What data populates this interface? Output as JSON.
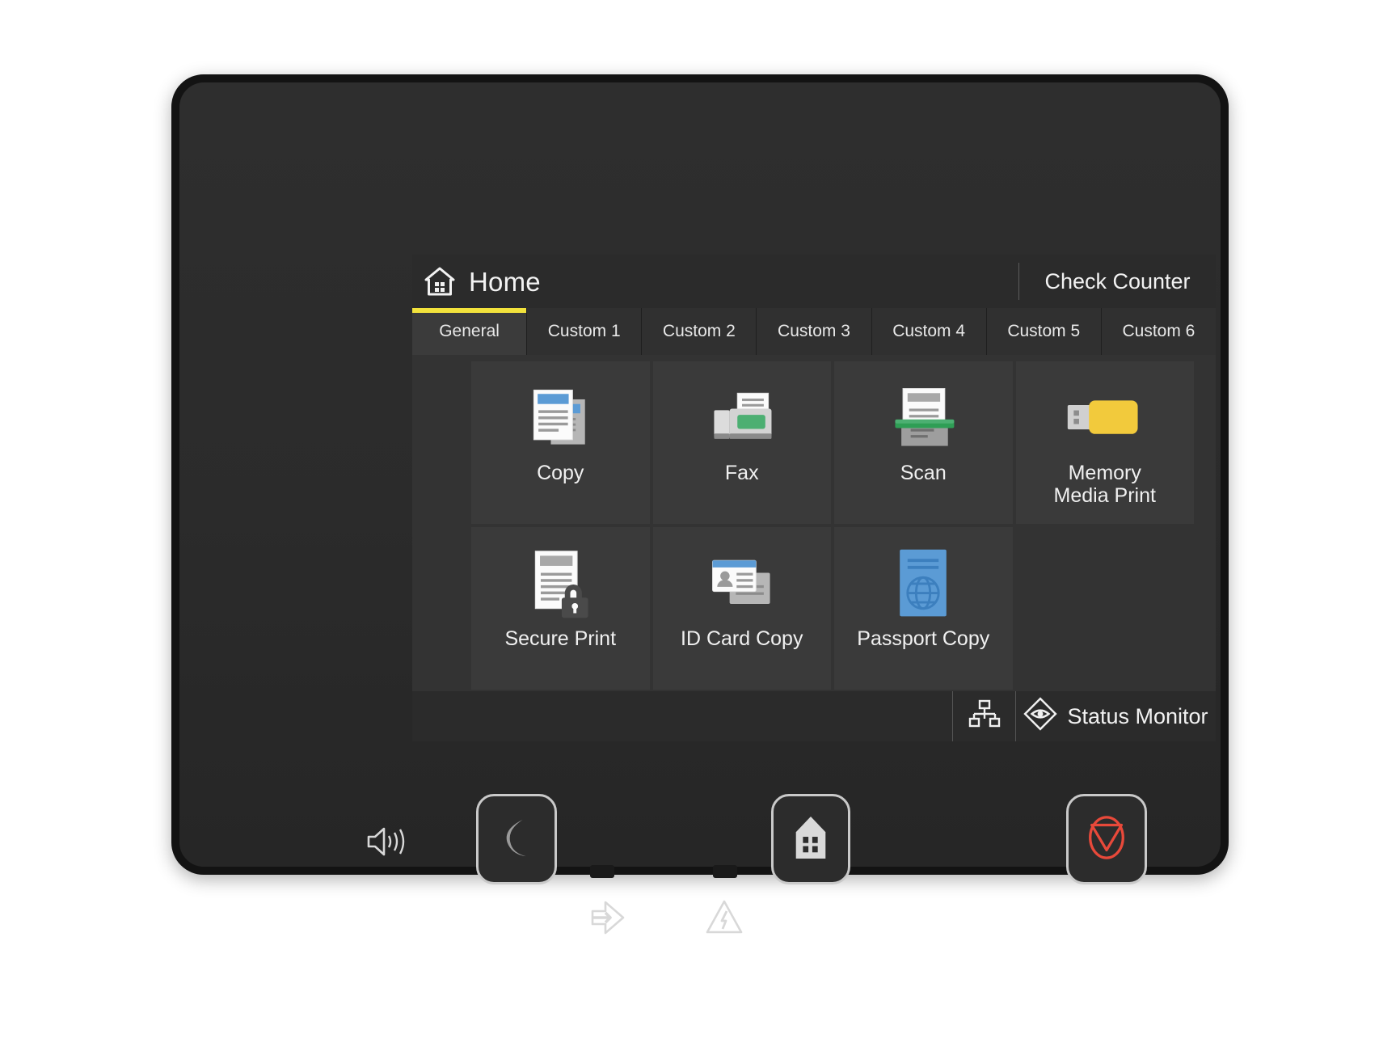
{
  "device": {
    "name": "multifunction-printer-control-panel"
  },
  "screen": {
    "header": {
      "home_icon": "home-icon",
      "title": "Home",
      "check_counter_label": "Check Counter"
    },
    "tabs": [
      {
        "label": "General",
        "active": true
      },
      {
        "label": "Custom 1",
        "active": false
      },
      {
        "label": "Custom 2",
        "active": false
      },
      {
        "label": "Custom 3",
        "active": false
      },
      {
        "label": "Custom 4",
        "active": false
      },
      {
        "label": "Custom 5",
        "active": false
      },
      {
        "label": "Custom 6",
        "active": false
      }
    ],
    "apps": [
      {
        "label": "Copy",
        "icon": "copy-document-icon"
      },
      {
        "label": "Fax",
        "icon": "fax-machine-icon"
      },
      {
        "label": "Scan",
        "icon": "scanner-icon"
      },
      {
        "label": "Memory\nMedia Print",
        "icon": "usb-flash-drive-icon"
      },
      {
        "label": "Secure Print",
        "icon": "document-lock-icon"
      },
      {
        "label": "ID Card Copy",
        "icon": "id-card-icon"
      },
      {
        "label": "Passport Copy",
        "icon": "passport-globe-icon"
      }
    ],
    "status_bar": {
      "network_icon": "network-lan-icon",
      "monitor_icon": "eye-diamond-icon",
      "monitor_label": "Status Monitor"
    }
  },
  "hardware": {
    "speaker_icon": "speaker-volume-icon",
    "buttons": [
      {
        "name": "sleep-button",
        "icon": "crescent-moon-icon"
      },
      {
        "name": "home-button",
        "icon": "home-icon"
      },
      {
        "name": "stop-button",
        "icon": "stop-circle-icon"
      }
    ],
    "indicators": [
      {
        "name": "data-indicator",
        "icon": "arrow-into-chevron-icon"
      },
      {
        "name": "error-indicator",
        "icon": "warning-triangle-icon"
      }
    ]
  },
  "colors": {
    "accent_yellow": "#f2e23c",
    "stop_red": "#e8493a",
    "blue": "#5b9bd5",
    "green": "#4caf72",
    "usb_yellow": "#f2ca3c",
    "screen_bg": "#2b2b2b",
    "tile_bg": "#3a3a3a"
  }
}
